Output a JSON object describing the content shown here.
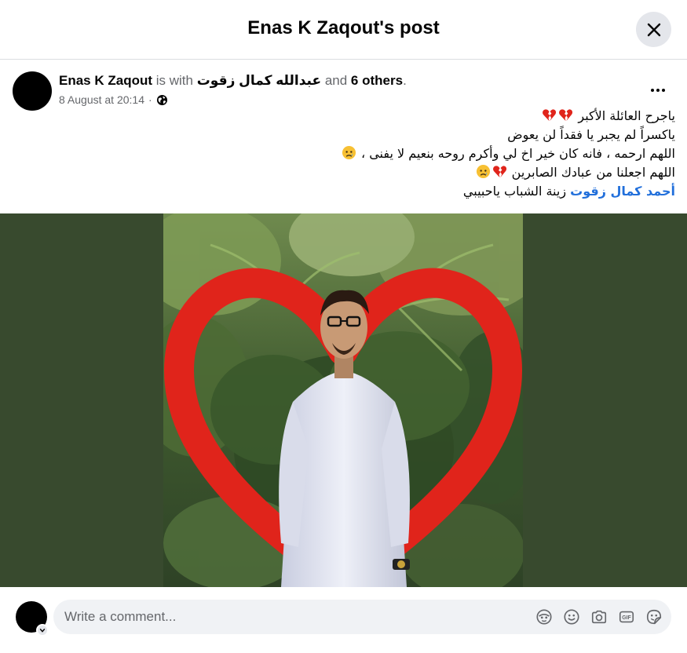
{
  "header": {
    "title": "Enas K Zaqout's post"
  },
  "post": {
    "author": "Enas K Zaqout",
    "is_with": "is with",
    "tagged": "عبدالله كمال زقوت",
    "and": "and",
    "others": "6 others",
    "period": ".",
    "date": "8 August at 20:14",
    "dot": "·",
    "lines": [
      "ياجرح العائلة الأكبر",
      "ياكسراً لم يجبر يا فقداً لن يعوض",
      "اللهم ارحمه ، فانه كان خير اخ لي وأكرم روحه بنعيم لا يفنى ،",
      "اللهم اجعلنا من عبادك الصابرين"
    ],
    "mention": "أحمد كمال زقوت",
    "last_text": "زينة الشباب ياحبيبي"
  },
  "comment": {
    "placeholder": "Write a comment..."
  },
  "icons": {
    "close": "close-icon",
    "globe": "globe-icon",
    "more": "more-options-icon",
    "broken_heart": "broken-heart-emoji",
    "sad_face": "sad-face-emoji",
    "avatar_sticker": "avatar-sticker-icon",
    "emoji": "emoji-icon",
    "camera": "camera-icon",
    "gif": "gif-icon",
    "sticker": "sticker-icon"
  },
  "colors": {
    "link": "#216fdb",
    "photo_background": "#384a2e",
    "heart": "#e0241b"
  }
}
